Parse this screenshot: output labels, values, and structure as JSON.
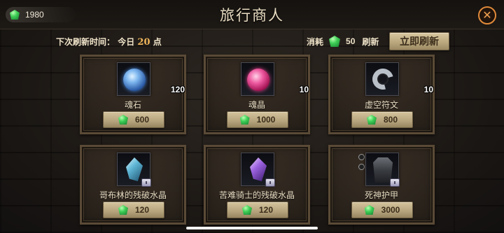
{
  "header": {
    "title": "旅行商人",
    "currency_amount": "1980",
    "close_symbol": "✕"
  },
  "refresh": {
    "label_prefix": "下次刷新时间：",
    "label_day": "今日",
    "hour": "20",
    "label_suffix": "点",
    "cost_label": "消耗",
    "cost_amount": "50",
    "cost_action": "刷新",
    "button_label": "立即刷新"
  },
  "items": [
    {
      "name": "魂石",
      "quantity": "120",
      "price": "600",
      "icon": "blue-orb-icon"
    },
    {
      "name": "魂晶",
      "quantity": "10",
      "price": "1000",
      "icon": "pink-orb-icon"
    },
    {
      "name": "虚空符文",
      "quantity": "10",
      "price": "800",
      "icon": "void-rune-icon"
    },
    {
      "name": "哥布林的残破水晶",
      "quantity": "",
      "price": "120",
      "icon": "cyan-crystal-icon"
    },
    {
      "name": "苦难骑士的残破水晶",
      "quantity": "",
      "price": "120",
      "icon": "purple-crystal-icon"
    },
    {
      "name": "死神护甲",
      "quantity": "",
      "price": "3000",
      "icon": "armor-icon"
    }
  ],
  "colors": {
    "gem": "#3fcf57",
    "accent_orange": "#e08a3a",
    "highlight_hour": "#f0b65a",
    "button_tan": "#c4b38c"
  }
}
